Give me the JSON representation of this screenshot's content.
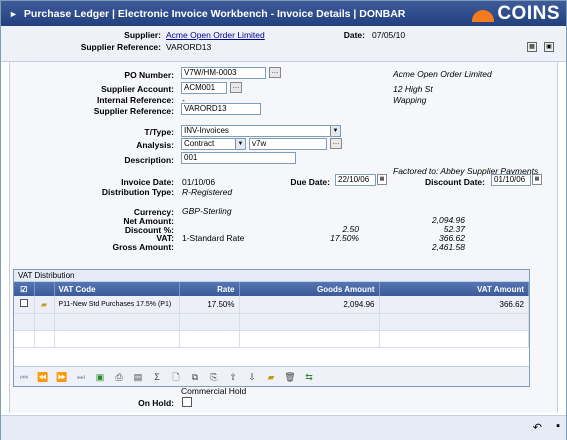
{
  "title": {
    "arrow": "►",
    "text": "Purchase Ledger | Electronic Invoice Workbench - Invoice Details | DONBAR",
    "logo": "COINS"
  },
  "header": {
    "supplier_label": "Supplier:",
    "supplier_value": "Acme Open Order Limited",
    "date_label": "Date:",
    "date_value": "07/05/10",
    "ref_label": "Supplier Reference:",
    "ref_value": "VARORD13"
  },
  "form": {
    "po_label": "PO Number:",
    "po_value": "V7W/HM-0003",
    "account_label": "Supplier Account:",
    "account_value": "ACM001",
    "internal_label": "Internal Reference:",
    "internal_value": "-",
    "supref_label": "Supplier Reference:",
    "supref_value": "VARORD13",
    "ttype_label": "T/Type:",
    "ttype_value": "INV-Invoices",
    "analysis_label": "Analysis:",
    "analysis_value": "Contract",
    "analysis_code": "v7w",
    "description_label": "Description:",
    "description_value": "001",
    "invoice_date_label": "Invoice Date:",
    "invoice_date_value": "01/10/06",
    "due_date_label": "Due Date:",
    "due_date_value": "22/10/06",
    "discount_date_label": "Discount Date:",
    "discount_date_value": "01/10/06",
    "dist_label": "Distribution Type:",
    "dist_value": "R-Registered",
    "currency_label": "Currency:",
    "currency_value": "GBP-Sterling",
    "net_label": "Net Amount:",
    "net_value": "2,094.96",
    "discount_label": "Discount %:",
    "discount_pct": "2.50",
    "discount_value": "52.37",
    "vat_label": "VAT:",
    "vat_rate_name": "1-Standard Rate",
    "vat_pct": "17.50%",
    "vat_value": "366.62",
    "gross_label": "Gross Amount:",
    "gross_value": "2,461.58"
  },
  "address": {
    "line1": "Acme Open Order Limited",
    "line2": "12 High St",
    "line3": "Wapping",
    "factored": "Factored to: Abbey Supplier Payments"
  },
  "vat_dist": {
    "title": "VAT Distribution",
    "columns": [
      "VAT Code",
      "Rate",
      "Goods Amount",
      "VAT Amount"
    ],
    "rows": [
      {
        "code": "P11-New Std Purchases 17.5% (P1)",
        "rate": "17.50%",
        "goods": "2,094.96",
        "vat": "366.62"
      }
    ]
  },
  "hold": {
    "section": "Commercial Hold",
    "label": "On Hold:"
  },
  "colors": {
    "title_bar": "#2f4d8c",
    "logo": "#f47a20",
    "table_header": "#4a6aa8"
  }
}
